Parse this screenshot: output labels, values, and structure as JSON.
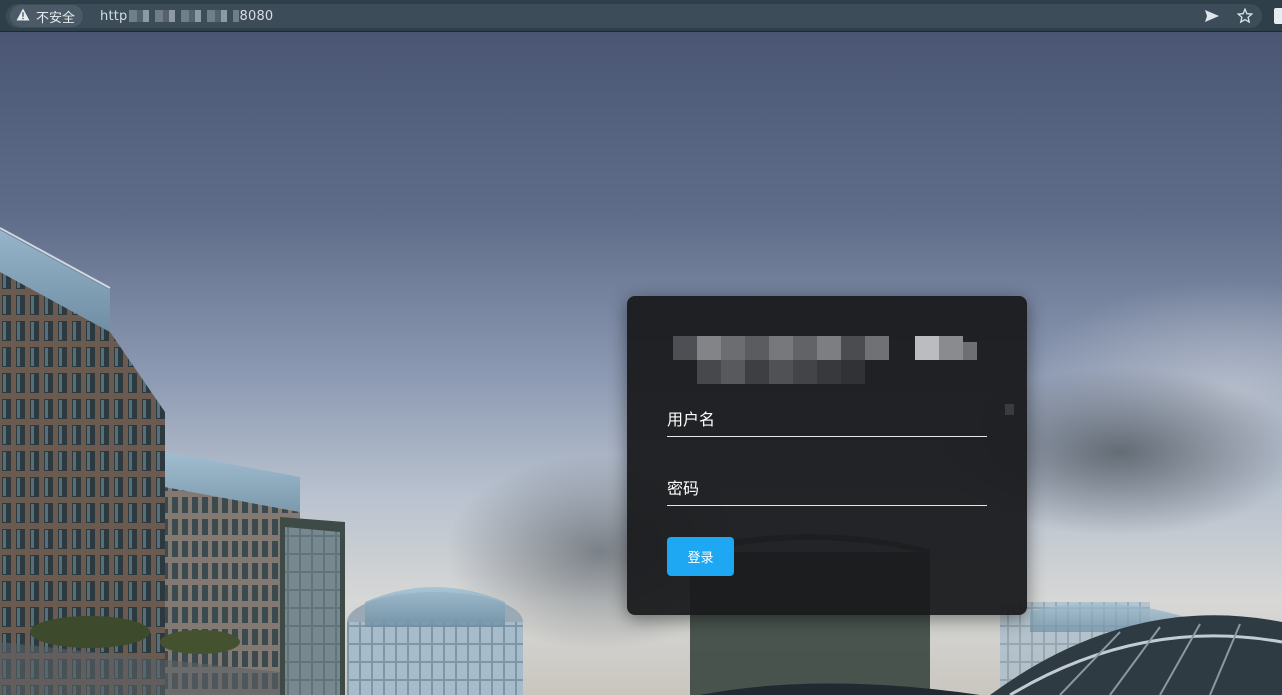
{
  "browser": {
    "security_label": "不安全",
    "url_prefix": "http",
    "url_suffix": "8080"
  },
  "colors": {
    "accent": "#1ea7f3",
    "card_bg": "#18191c",
    "toolbar_bg": "#2f3f4a"
  },
  "icons": {
    "security": "warning-icon",
    "send": "send-icon",
    "bookmark": "star-icon"
  },
  "login": {
    "username_placeholder": "用户名",
    "password_placeholder": "密码",
    "submit_label": "登录"
  }
}
